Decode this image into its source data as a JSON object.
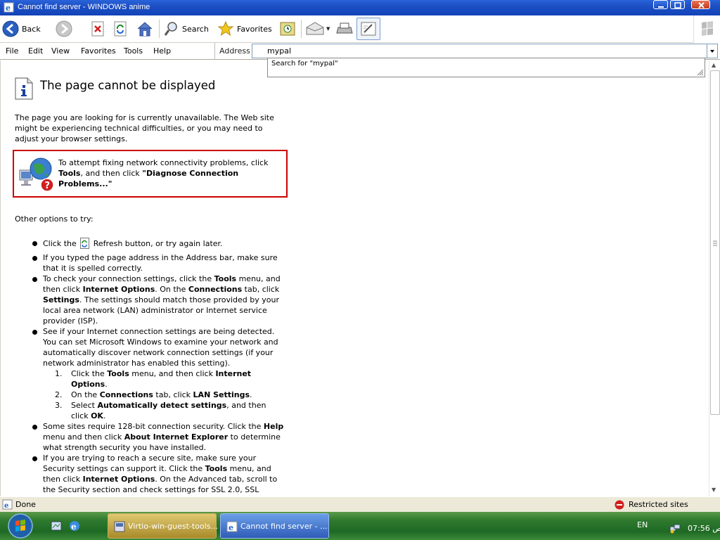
{
  "window": {
    "title": "Cannot find server - WINDOWS anime"
  },
  "toolbar": {
    "back": "Back",
    "search": "Search",
    "favorites": "Favorites"
  },
  "menu": [
    "File",
    "Edit",
    "View",
    "Favorites",
    "Tools",
    "Help"
  ],
  "address": {
    "label": "Address",
    "value": "mypal",
    "suggestion": "Search for \"mypal\""
  },
  "page": {
    "title": "The page cannot be displayed",
    "intro": "The page you are looking for is currently unavailable. The Web site might be experiencing technical difficulties, or you may need to adjust your browser settings.",
    "diagnose": {
      "t1": "To attempt fixing network connectivity problems, click ",
      "t2": "Tools",
      "t3": ", and then click ",
      "t4": "\"Diagnose Connection Problems...\""
    },
    "other_heading": "Other options to try:",
    "b1": {
      "a": "Click the ",
      "b": " Refresh button, or try again later."
    },
    "b2": "If you typed the page address in the Address bar, make sure that it is spelled correctly.",
    "b3": {
      "a": "To check your connection settings, click the ",
      "b": "Tools",
      "c": " menu, and then click ",
      "d": "Internet Options",
      "e": ". On the ",
      "f": "Connections",
      "g": " tab, click ",
      "h": "Settings",
      "i": ". The settings should match those provided by your local area network (LAN) administrator or Internet service provider (ISP)."
    },
    "b4": "See if your Internet connection settings are being detected. You can set Microsoft Windows to examine your network and automatically discover network connection settings (if your network administrator has enabled this setting).",
    "ol": {
      "n1": "1.",
      "n2": "2.",
      "n3": "3.",
      "s1a": "Click the ",
      "s1b": "Tools",
      "s1c": " menu, and then click ",
      "s1d": "Internet Options",
      "s1e": ".",
      "s2a": "On the ",
      "s2b": "Connections",
      "s2c": " tab, click ",
      "s2d": "LAN Settings",
      "s2e": ".",
      "s3a": "Select ",
      "s3b": "Automatically detect settings",
      "s3c": ", and then click ",
      "s3d": "OK",
      "s3e": "."
    },
    "b5": {
      "a": "Some sites require 128-bit connection security. Click the ",
      "b": "Help",
      "c": " menu and then click ",
      "d": "About Internet Explorer",
      "e": " to determine what strength security you have installed."
    },
    "b6": {
      "a": "If you are trying to reach a secure site, make sure your Security settings can support it. Click the ",
      "b": "Tools",
      "c": " menu, and then click ",
      "d": "Internet Options",
      "e": ". On the Advanced tab, scroll to the Security section and check settings for SSL 2.0, SSL"
    }
  },
  "status": {
    "text": "Done",
    "zone": "Restricted sites"
  },
  "taskbar": {
    "task1": "Virtio-win-guest-tools...",
    "task2": "Cannot find server - ...",
    "lang": "EN",
    "clock": "07:56 ص"
  }
}
